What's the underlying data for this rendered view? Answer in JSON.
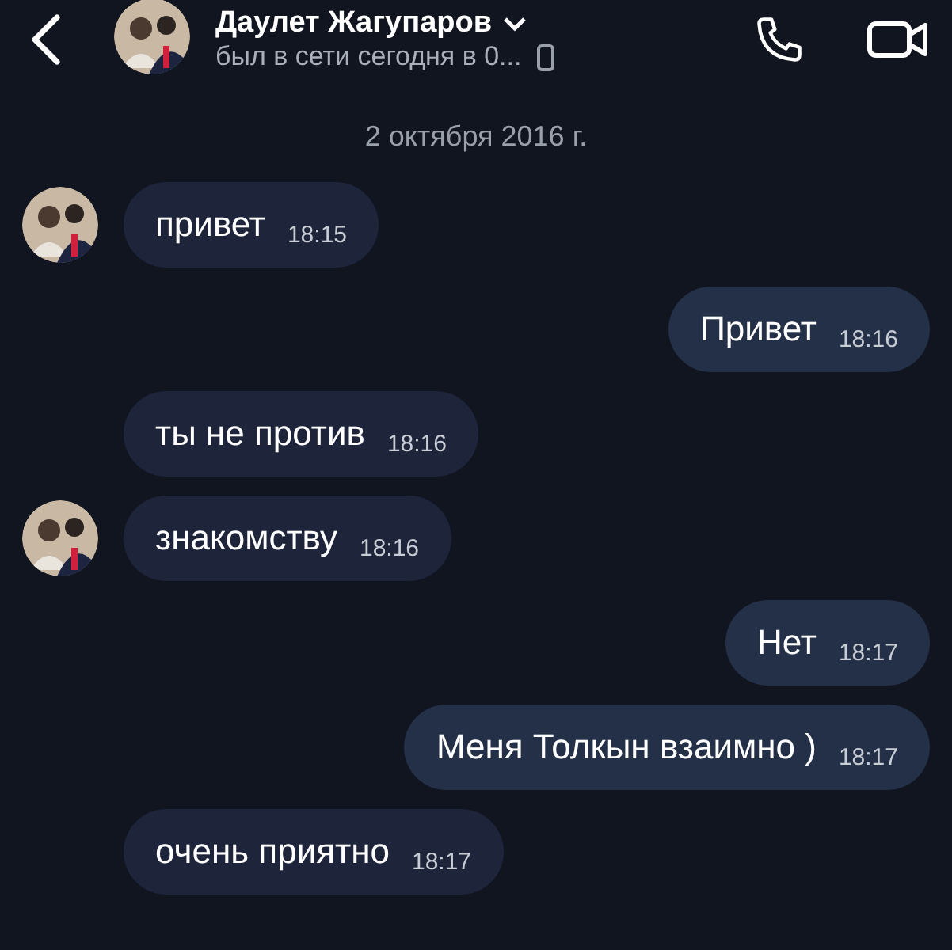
{
  "header": {
    "name": "Даулет Жагупаров",
    "status": "был в сети сегодня в 0..."
  },
  "date": "2 октября 2016 г.",
  "messages": [
    {
      "kind": "in",
      "text": "привет",
      "time": "18:15",
      "avatar": true
    },
    {
      "kind": "out",
      "text": "Привет",
      "time": "18:16",
      "avatar": false
    },
    {
      "kind": "in",
      "text": "ты не против",
      "time": "18:16",
      "avatar": false
    },
    {
      "kind": "in",
      "text": "знакомству",
      "time": "18:16",
      "avatar": true
    },
    {
      "kind": "out",
      "text": "Нет",
      "time": "18:17",
      "avatar": false
    },
    {
      "kind": "out",
      "text": "Меня Толкын взаимно )",
      "time": "18:17",
      "avatar": false
    },
    {
      "kind": "in",
      "text": "очень приятно",
      "time": "18:17",
      "avatar": false
    }
  ]
}
